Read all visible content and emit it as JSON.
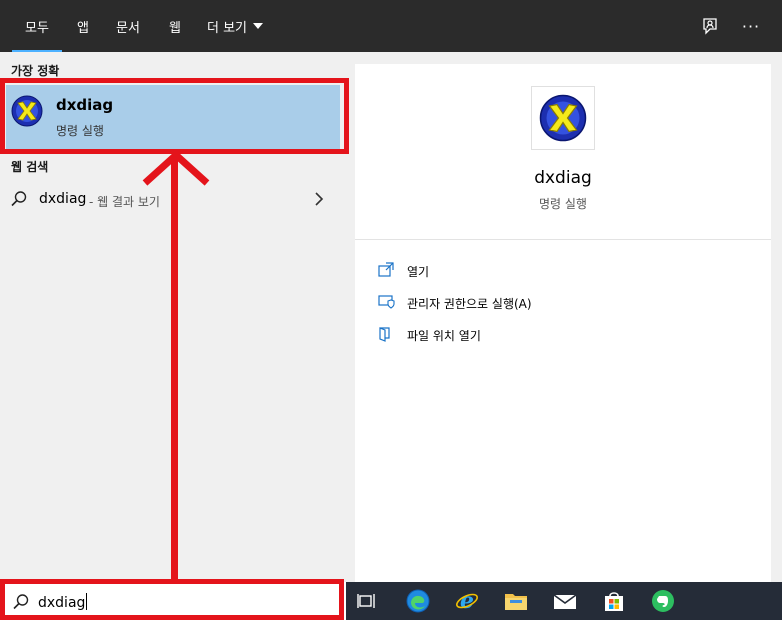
{
  "tabs": [
    {
      "label": "모두",
      "active": true
    },
    {
      "label": "앱"
    },
    {
      "label": "문서"
    },
    {
      "label": "웹"
    },
    {
      "label": "더 보기"
    }
  ],
  "header_icons": {
    "feedback": "feedback-icon",
    "more": "more-options-icon",
    "more_glyph": "···"
  },
  "best_match": {
    "header": "가장 정확",
    "title": "dxdiag",
    "subtitle": "명령 실행",
    "icon": "directx-icon"
  },
  "web_search": {
    "header": "웹 검색",
    "query": "dxdiag",
    "suffix": "- 웹 결과 보기"
  },
  "preview": {
    "title": "dxdiag",
    "subtitle": "명령 실행",
    "actions": [
      {
        "label": "열기",
        "icon": "open-icon"
      },
      {
        "label": "관리자 권한으로 실행(A)",
        "icon": "run-as-admin-icon"
      },
      {
        "label": "파일 위치 열기",
        "icon": "open-file-location-icon"
      }
    ]
  },
  "search": {
    "value": "dxdiag"
  },
  "taskbar": [
    {
      "name": "task-view-icon"
    },
    {
      "name": "edge-icon"
    },
    {
      "name": "internet-explorer-icon"
    },
    {
      "name": "file-explorer-icon"
    },
    {
      "name": "mail-icon"
    },
    {
      "name": "store-icon"
    },
    {
      "name": "evernote-icon"
    }
  ],
  "colors": {
    "accent": "#4cb1ff",
    "highlight": "#a9cde9",
    "annotation_red": "#e4141b",
    "topbar": "#2b2b2b",
    "taskbar": "#252c38"
  }
}
